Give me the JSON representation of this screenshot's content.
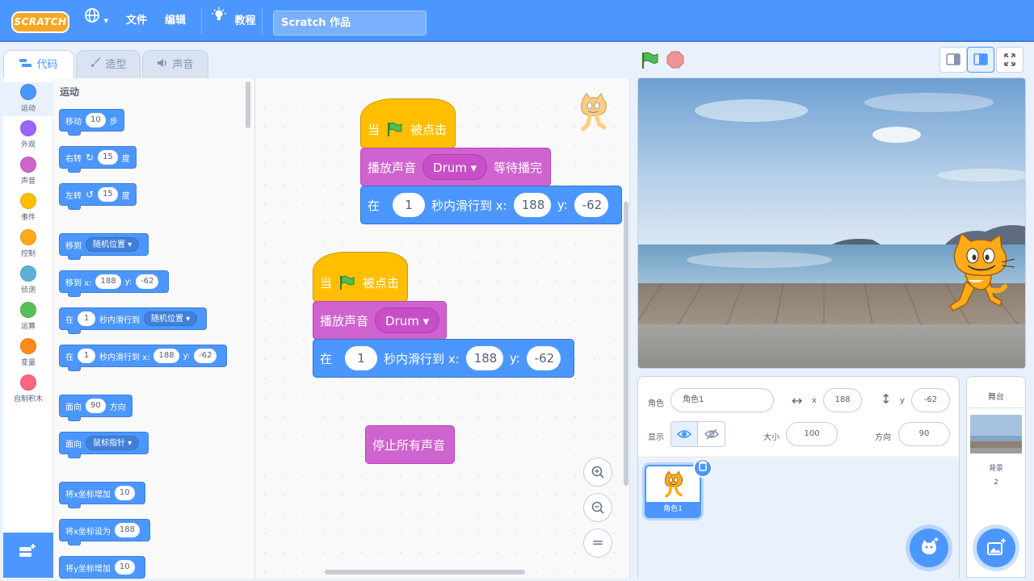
{
  "menubar": {
    "logo_text": "SCRATCH",
    "globe_caret": "▾",
    "file": "文件",
    "edit": "编辑",
    "tutorials": "教程",
    "project_title": "Scratch 作品"
  },
  "tabs": [
    {
      "label": "代码",
      "icon": "code-icon"
    },
    {
      "label": "造型",
      "icon": "brush-icon"
    },
    {
      "label": "声音",
      "icon": "speaker-icon"
    }
  ],
  "categories": [
    {
      "label": "运动",
      "color": "#4c97ff"
    },
    {
      "label": "外观",
      "color": "#9966ff"
    },
    {
      "label": "声音",
      "color": "#cf63cf"
    },
    {
      "label": "事件",
      "color": "#ffbf00"
    },
    {
      "label": "控制",
      "color": "#ffab19"
    },
    {
      "label": "侦测",
      "color": "#5cb1d6"
    },
    {
      "label": "运算",
      "color": "#59c059"
    },
    {
      "label": "变量",
      "color": "#ff8c1a"
    },
    {
      "label": "自制积木",
      "color": "#ff6680"
    }
  ],
  "palette": {
    "title": "运动",
    "move": {
      "pre": "移动",
      "value": "10",
      "post": "步"
    },
    "turn_right": {
      "pre": "右转",
      "value": "15",
      "post": "度"
    },
    "turn_left": {
      "pre": "左转",
      "value": "15",
      "post": "度"
    },
    "goto": {
      "pre": "移到",
      "drop": "随机位置"
    },
    "goto_xy": {
      "pre": "移到 x:",
      "x": "188",
      "ylabel": "y:",
      "y": "-62"
    },
    "glide_random": {
      "pre": "在",
      "secs": "1",
      "mid": "秒内滑行到",
      "drop": "随机位置"
    },
    "glide_xy": {
      "pre": "在",
      "secs": "1",
      "mid": "秒内滑行到 x:",
      "x": "188",
      "ylabel": "y:",
      "y": "-62"
    },
    "point_dir": {
      "pre": "面向",
      "value": "90",
      "post": "方向"
    },
    "point_towards": {
      "pre": "面向",
      "drop": "鼠标指针"
    },
    "change_x": {
      "pre": "将x坐标增加",
      "value": "10"
    },
    "set_x": {
      "pre": "将x坐标设为",
      "value": "188"
    },
    "change_y": {
      "pre": "将y坐标增加",
      "value": "10"
    }
  },
  "script1": {
    "hat_pre": "当",
    "hat_post": "被点击",
    "play_pre": "播放声音",
    "play_sound": "Drum",
    "play_post": "等待播完",
    "glide_pre": "在",
    "secs": "1",
    "glide_mid": "秒内滑行到 x:",
    "x": "188",
    "ylabel": "y:",
    "y": "-62"
  },
  "script2": {
    "hat_pre": "当",
    "hat_post": "被点击",
    "play_pre": "播放声音",
    "play_sound": "Drum",
    "glide_pre": "在",
    "secs": "1",
    "glide_mid": "秒内滑行到 x:",
    "x": "188",
    "ylabel": "y:",
    "y": "-62"
  },
  "stop_all_sounds": "停止所有声音",
  "zoom": {
    "in": "+",
    "out": "−",
    "reset": "="
  },
  "sprite_info": {
    "sprite_label": "角色",
    "sprite_name": "角色1",
    "x_label": "x",
    "x": "188",
    "y_label": "y",
    "y": "-62",
    "show_label": "显示",
    "size_label": "大小",
    "size": "100",
    "direction_label": "方向",
    "direction": "90"
  },
  "sprite_list": [
    {
      "name": "角色1"
    }
  ],
  "stage_panel": {
    "title": "舞台",
    "backdrops_label": "背景",
    "backdrops_count": "2"
  }
}
